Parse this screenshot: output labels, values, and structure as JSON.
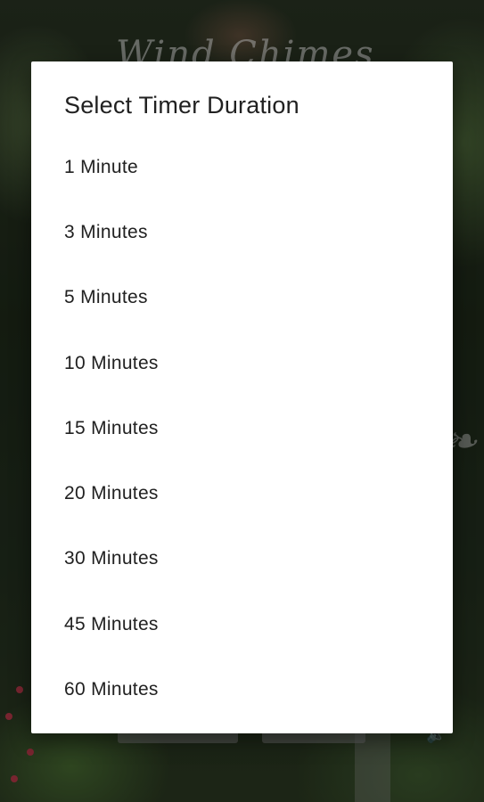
{
  "background": {
    "title_text": "Wind Chimes",
    "ornament_text": "&"
  },
  "dialog": {
    "title": "Select Timer Duration",
    "options": [
      {
        "label": "1 Minute"
      },
      {
        "label": "3 Minutes"
      },
      {
        "label": "5 Minutes"
      },
      {
        "label": "10 Minutes"
      },
      {
        "label": "15 Minutes"
      },
      {
        "label": "20 Minutes"
      },
      {
        "label": "30 Minutes"
      },
      {
        "label": "45 Minutes"
      },
      {
        "label": "60 Minutes"
      }
    ]
  },
  "icons": {
    "volume": "volume-icon"
  },
  "colors": {
    "dialog_bg": "#ffffff",
    "text": "#212121",
    "scrim": "rgba(0,0,0,0.35)"
  }
}
